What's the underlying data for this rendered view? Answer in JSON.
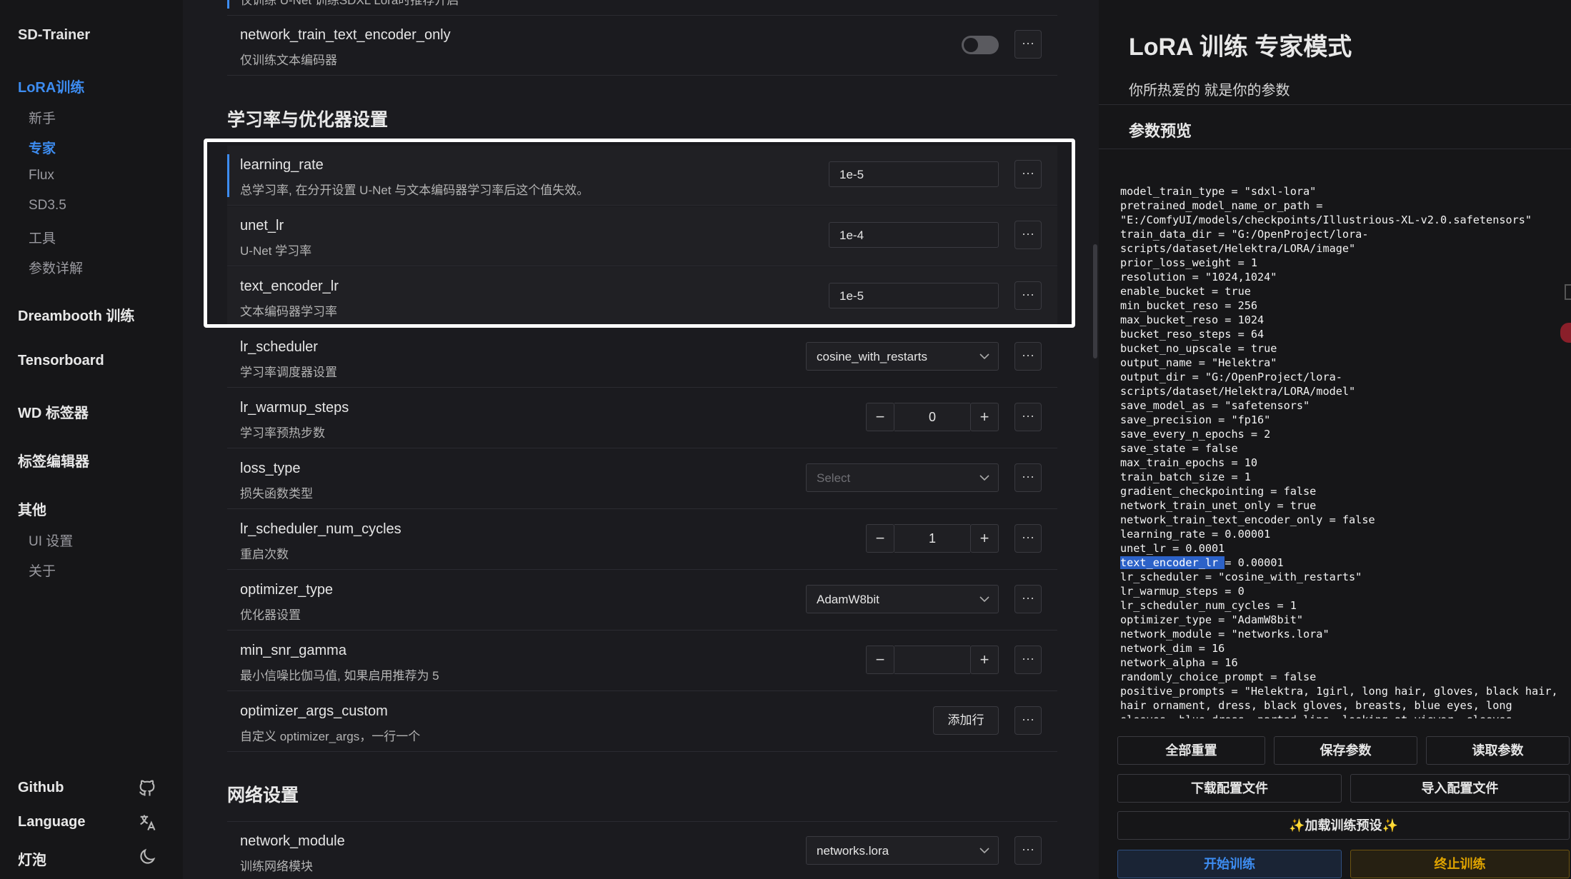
{
  "sidebar": {
    "brand": "SD-Trainer",
    "lora_group": "LoRA训练",
    "lora_items": [
      "新手",
      "专家",
      "Flux",
      "SD3.5",
      "工具",
      "参数详解"
    ],
    "active_item": "专家",
    "groups": [
      "Dreambooth 训练",
      "Tensorboard",
      "WD 标签器",
      "标签编辑器",
      "其他"
    ],
    "other_items": [
      "UI 设置",
      "关于"
    ],
    "bottom": {
      "github": "Github",
      "language": "Language",
      "theme": "灯泡"
    }
  },
  "main": {
    "top_fragment": "仅训练 U-Net 训练SDXL Lora时推荐开启",
    "toggle_row": {
      "title": "network_train_text_encoder_only",
      "desc": "仅训练文本编码器",
      "checked": false
    },
    "section_lr": "学习率与优化器设置",
    "rows": [
      {
        "title": "learning_rate",
        "desc": "总学习率, 在分开设置 U-Net 与文本编码器学习率后这个值失效。",
        "value": "1e-5"
      },
      {
        "title": "unet_lr",
        "desc": "U-Net 学习率",
        "value": "1e-4"
      },
      {
        "title": "text_encoder_lr",
        "desc": "文本编码器学习率",
        "value": "1e-5"
      },
      {
        "title": "lr_scheduler",
        "desc": "学习率调度器设置",
        "value": "cosine_with_restarts"
      },
      {
        "title": "lr_warmup_steps",
        "desc": "学习率预热步数",
        "value": "0"
      },
      {
        "title": "loss_type",
        "desc": "损失函数类型",
        "placeholder": "Select"
      },
      {
        "title": "lr_scheduler_num_cycles",
        "desc": "重启次数",
        "value": "1"
      },
      {
        "title": "optimizer_type",
        "desc": "优化器设置",
        "value": "AdamW8bit"
      },
      {
        "title": "min_snr_gamma",
        "desc": "最小信噪比伽马值, 如果启用推荐为 5",
        "value": ""
      },
      {
        "title": "optimizer_args_custom",
        "desc": "自定义 optimizer_args，一行一个",
        "button": "添加行"
      }
    ],
    "section_network": "网络设置",
    "network_row": {
      "title": "network_module",
      "desc": "训练网络模块",
      "value": "networks.lora"
    },
    "more_label": "···",
    "minus": "−",
    "plus": "+"
  },
  "right_panel": {
    "title": "LoRA 训练 专家模式",
    "subtitle": "你所热爱的 就是你的参数",
    "preview_heading": "参数预览",
    "selected_text": "text_encoder_lr ",
    "code_lines": [
      "model_train_type = \"sdxl-lora\"",
      "pretrained_model_name_or_path =",
      "\"E:/ComfyUI/models/checkpoints/Illustrious-XL-v2.0.safetensors\"",
      "train_data_dir = \"G:/OpenProject/lora-",
      "scripts/dataset/Helektra/LORA/image\"",
      "prior_loss_weight = 1",
      "resolution = \"1024,1024\"",
      "enable_bucket = true",
      "min_bucket_reso = 256",
      "max_bucket_reso = 1024",
      "bucket_reso_steps = 64",
      "bucket_no_upscale = true",
      "output_name = \"Helektra\"",
      "output_dir = \"G:/OpenProject/lora-",
      "scripts/dataset/Helektra/LORA/model\"",
      "save_model_as = \"safetensors\"",
      "save_precision = \"fp16\"",
      "save_every_n_epochs = 2",
      "save_state = false",
      "max_train_epochs = 10",
      "train_batch_size = 1",
      "gradient_checkpointing = false",
      "network_train_unet_only = true",
      "network_train_text_encoder_only = false",
      "learning_rate = 0.00001",
      "unet_lr = 0.0001",
      "text_encoder_lr = 0.00001",
      "lr_scheduler = \"cosine_with_restarts\"",
      "lr_warmup_steps = 0",
      "lr_scheduler_num_cycles = 1",
      "optimizer_type = \"AdamW8bit\"",
      "network_module = \"networks.lora\"",
      "network_dim = 16",
      "network_alpha = 16",
      "randomly_choice_prompt = false",
      "positive_prompts = \"Helektra, 1girl, long hair, gloves, black hair,",
      "hair ornament, dress, black gloves, breasts, blue eyes, long",
      "sleeves, blue dress, parted lips, looking at viewer, sleeves"
    ],
    "buttons": {
      "reset_all": "全部重置",
      "save_params": "保存参数",
      "read_params": "读取参数",
      "download_config": "下载配置文件",
      "import_config": "导入配置文件",
      "load_preset": "✨加载训练预设✨",
      "start": "开始训练",
      "stop": "终止训练"
    }
  }
}
